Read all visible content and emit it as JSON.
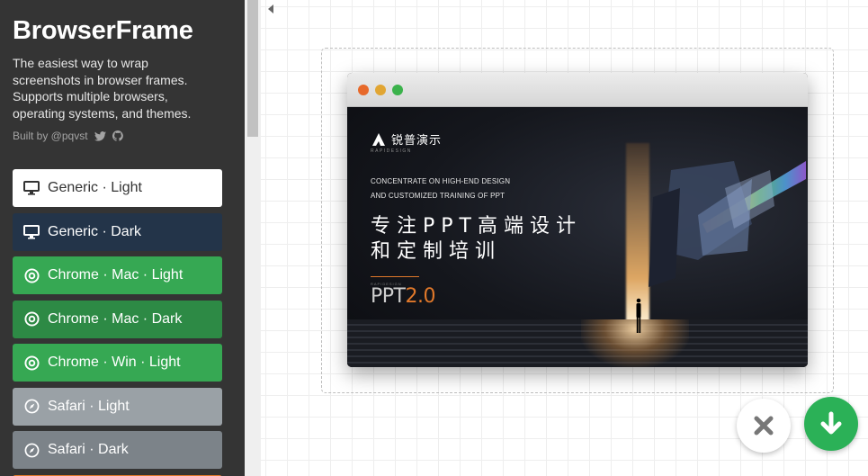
{
  "app": {
    "title": "BrowserFrame",
    "tagline": "The easiest way to wrap screenshots in browser frames. Supports multiple browsers, operating systems, and themes.",
    "byline": "Built by @pqvst"
  },
  "themes": [
    {
      "label": "Generic · Light",
      "icon": "monitor-icon",
      "style": "light"
    },
    {
      "label": "Generic · Dark",
      "icon": "monitor-icon",
      "style": "dark"
    },
    {
      "label": "Chrome · Mac · Light",
      "icon": "chrome-icon",
      "style": "chrome"
    },
    {
      "label": "Chrome · Mac · Dark",
      "icon": "chrome-icon",
      "style": "chrome-selected"
    },
    {
      "label": "Chrome · Win · Light",
      "icon": "chrome-icon",
      "style": "chrome"
    },
    {
      "label": "Safari · Light",
      "icon": "compass-icon",
      "style": "safari"
    },
    {
      "label": "Safari · Dark",
      "icon": "compass-icon",
      "style": "safari-dark"
    }
  ],
  "preview": {
    "logo_text": "锐普演示",
    "logo_sub": "RAPIDESIGN",
    "headline_en_1": "CONCENTRATE ON HIGH-END DESIGN",
    "headline_en_2": "AND CUSTOMIZED TRAINING OF PPT",
    "headline_cn_1": "专注PPT高端设计",
    "headline_cn_2": "和定制培训",
    "version_prefix": "PPT",
    "version_num": "2.0",
    "version_small": "RAPIDESIGN"
  },
  "colors": {
    "sidebar_bg": "#343434",
    "chrome_green": "#36a853",
    "download_green": "#2bb157",
    "accent_orange": "#e0782a"
  }
}
